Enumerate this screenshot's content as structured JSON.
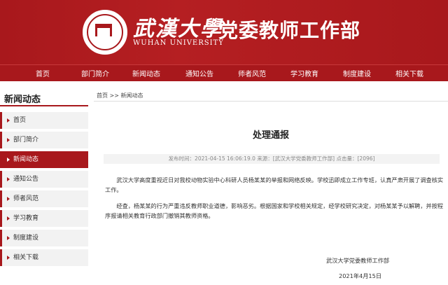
{
  "header": {
    "school_cn": "武漢大學",
    "school_en": "WUHAN UNIVERSITY",
    "dept_title": "党委教师工作部"
  },
  "nav": [
    "首页",
    "部门简介",
    "新闻动态",
    "通知公告",
    "师者风范",
    "学习教育",
    "制度建设",
    "相关下载"
  ],
  "sidebar": {
    "title": "新闻动态",
    "items": [
      "首页",
      "部门简介",
      "新闻动态",
      "通知公告",
      "师者风范",
      "学习教育",
      "制度建设",
      "相关下载"
    ],
    "active_index": 2
  },
  "breadcrumb": "首页 >> 新闻动态",
  "article": {
    "title": "处理通报",
    "meta": "发布时间：2021-04-15 16:06:19.0 来源：[武汉大学党委教师工作部] 点击量：[2096]",
    "paragraphs": [
      "武汉大学高度重视近日对我校动物实验中心科研人员杨某某的举报和网络反映。学校迅即成立工作专班，认真严肃开展了调查核实工作。",
      "经查，杨某某的行为严重违反教师职业道德，影响恶劣。根据国家和学校相关规定，经学校研究决定，对杨某某予以解聘，并按程序报请相关教育行政部门撤销其教师资格。"
    ],
    "signature": "武汉大学党委教师工作部",
    "date": "2021年4月15日"
  },
  "colors": {
    "brand": "#a8181c"
  }
}
